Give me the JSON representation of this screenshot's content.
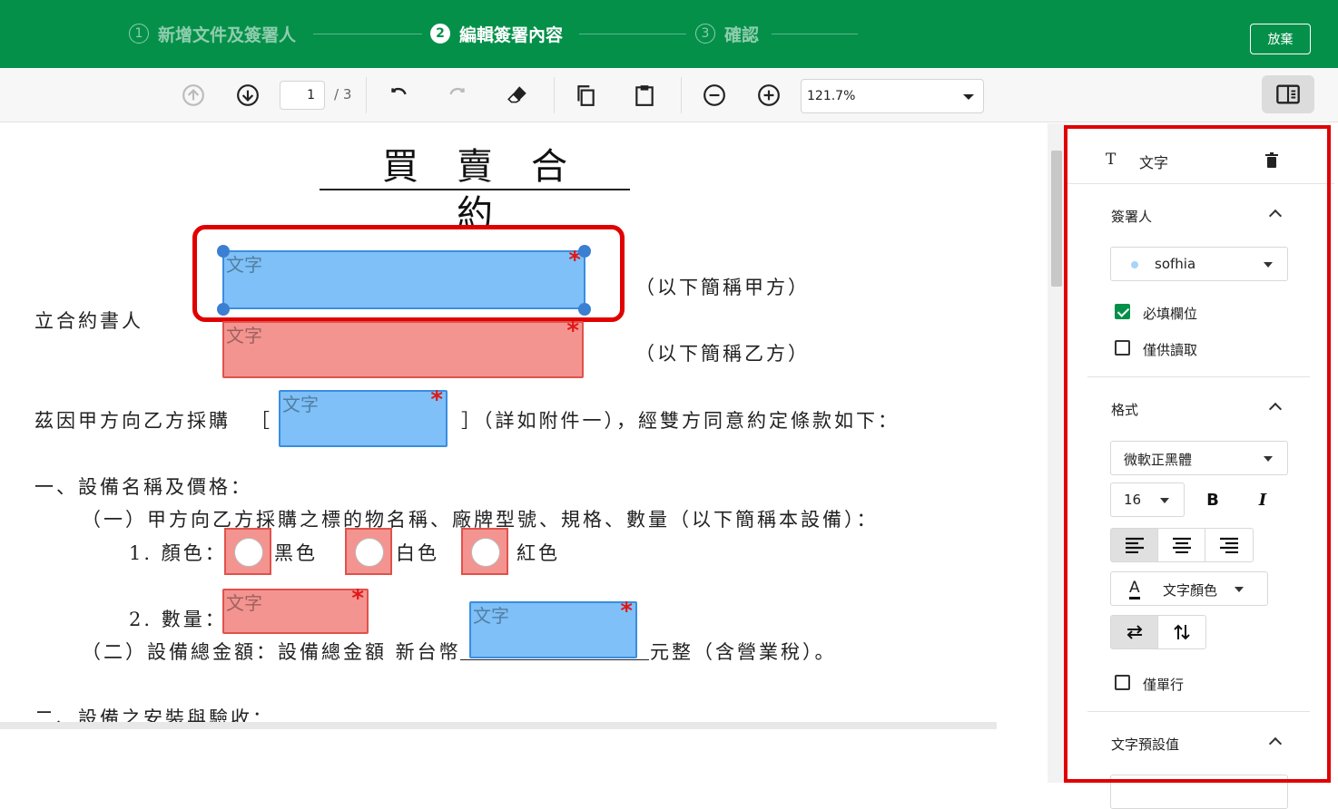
{
  "steps": [
    {
      "num": "1",
      "label": "新增文件及簽署人"
    },
    {
      "num": "2",
      "label": "編輯簽署內容"
    },
    {
      "num": "3",
      "label": "確認"
    }
  ],
  "header": {
    "discard_label": "放棄"
  },
  "toolbar": {
    "current_page": "1",
    "total_pages": "/ 3",
    "zoom": "121.7%"
  },
  "document": {
    "title": "買賣合約",
    "lines": {
      "party_label": "立合約書人",
      "party_a": "（以下簡稱甲方）",
      "party_b": "（以下簡稱乙方）",
      "purchase_prefix": "茲因甲方向乙方採購",
      "bracket_open": "［",
      "purchase_suffix": "］（詳如附件一），經雙方同意約定條款如下：",
      "section1": "一、設備名稱及價格：",
      "section1_1": "（一）甲方向乙方採購之標的物名稱、廠牌型號、規格、數量（以下簡稱本設備）：",
      "color_label": "1.  顏色：",
      "color_black": "黑色",
      "color_white": "白色",
      "color_red": "紅色",
      "qty_label": "2.  數量：",
      "section1_2": "（二）設備總金額：設備總金額  新台幣",
      "section1_2_suffix": "元整（含營業稅）。",
      "section2": "二、設備之安裝與驗收："
    },
    "field_label": "文字",
    "required_mark": "*"
  },
  "panel": {
    "type_icon": "T",
    "type_label": "文字",
    "signer_section": "簽署人",
    "signer_name": "sofhia",
    "required_label": "必填欄位",
    "required_checked": true,
    "readonly_label": "僅供讀取",
    "readonly_checked": false,
    "format_section": "格式",
    "font_name": "微軟正黑體",
    "font_size": "16",
    "bold_label": "B",
    "italic_label": "I",
    "text_color_label": "文字顏色",
    "text_color_icon_label": "A",
    "single_line_label": "僅單行",
    "single_line_checked": false,
    "defaults_section": "文字預設值"
  },
  "colors": {
    "brand_green": "#05904a",
    "field_blue": "#7ec0f7",
    "field_red": "#f39490",
    "highlight_red": "#e00000"
  }
}
